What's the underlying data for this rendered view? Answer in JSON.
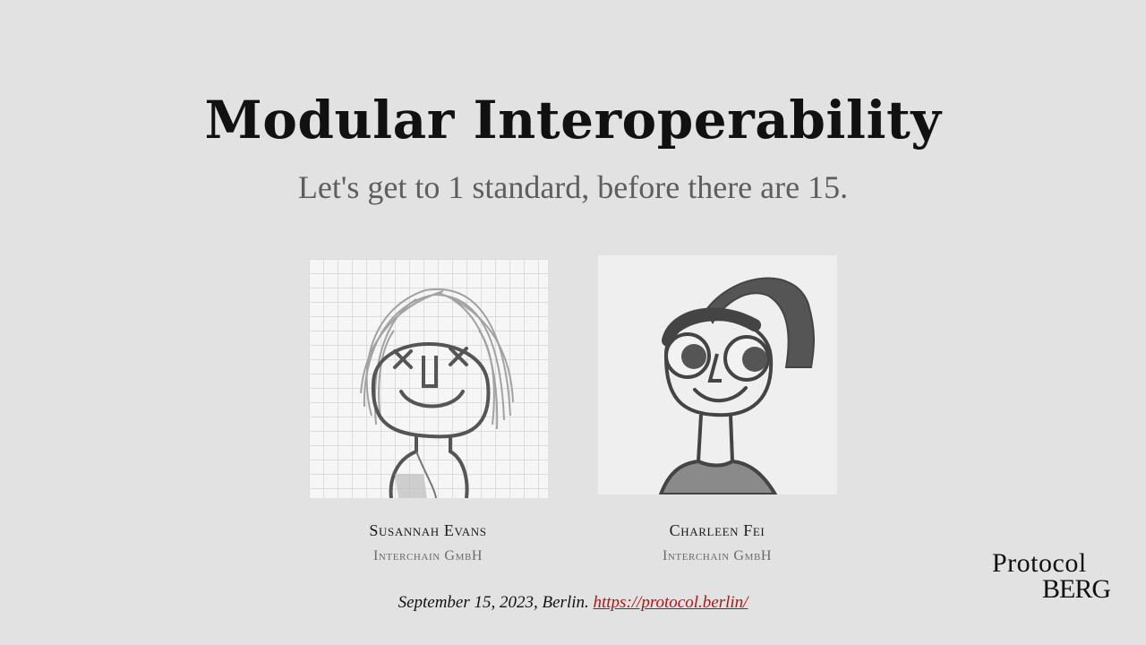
{
  "slide": {
    "title": "Modular Interoperability",
    "subtitle": "Let's get to 1 standard, before there are 15."
  },
  "authors": [
    {
      "name": "Susannah Evans",
      "org": "Interchain GmbH"
    },
    {
      "name": "Charleen Fei",
      "org": "Interchain GmbH"
    }
  ],
  "footer": {
    "date_place": "September 15, 2023, Berlin.",
    "link": "https://protocol.berlin/"
  },
  "logo": {
    "line1": "Protocol",
    "line2": "BERG"
  }
}
